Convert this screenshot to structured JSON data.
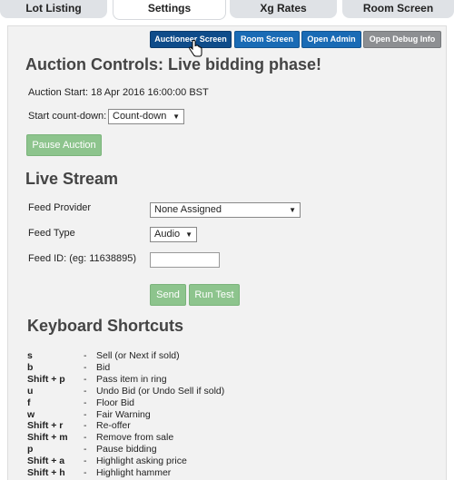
{
  "tabs": [
    {
      "label": "Lot Listing"
    },
    {
      "label": "Settings"
    },
    {
      "label": "Xg Rates"
    },
    {
      "label": "Room Screen"
    }
  ],
  "top_buttons": {
    "auctioneer": "Auctioneer Screen",
    "room": "Room Screen",
    "admin": "Open Admin",
    "debug": "Open Debug Info"
  },
  "auction": {
    "title": "Auction Controls: Live bidding phase!",
    "start_label": "Auction Start: 18 Apr 2016 16:00:00 BST",
    "countdown_label": "Start count-down:",
    "countdown_value": "Count-down",
    "pause_button": "Pause Auction"
  },
  "live_stream": {
    "title": "Live Stream",
    "provider_label": "Feed Provider",
    "provider_value": "None Assigned",
    "type_label": "Feed Type",
    "type_value": "Audio",
    "id_label": "Feed ID: (eg: 11638895)",
    "id_value": "",
    "send_button": "Send",
    "run_test_button": "Run Test"
  },
  "shortcuts": {
    "title": "Keyboard Shortcuts",
    "items": [
      {
        "key": "s",
        "desc": "Sell (or Next if sold)"
      },
      {
        "key": "b",
        "desc": "Bid"
      },
      {
        "key": "Shift + p",
        "desc": "Pass item in ring"
      },
      {
        "key": "u",
        "desc": "Undo Bid (or Undo Sell if sold)"
      },
      {
        "key": "f",
        "desc": "Floor Bid"
      },
      {
        "key": "w",
        "desc": "Fair Warning"
      },
      {
        "key": "Shift + r",
        "desc": "Re-offer"
      },
      {
        "key": "Shift + m",
        "desc": "Remove from sale"
      },
      {
        "key": "p",
        "desc": "Pause bidding"
      },
      {
        "key": "Shift + a",
        "desc": "Highlight asking price"
      },
      {
        "key": "Shift + h",
        "desc": "Highlight hammer"
      }
    ]
  }
}
